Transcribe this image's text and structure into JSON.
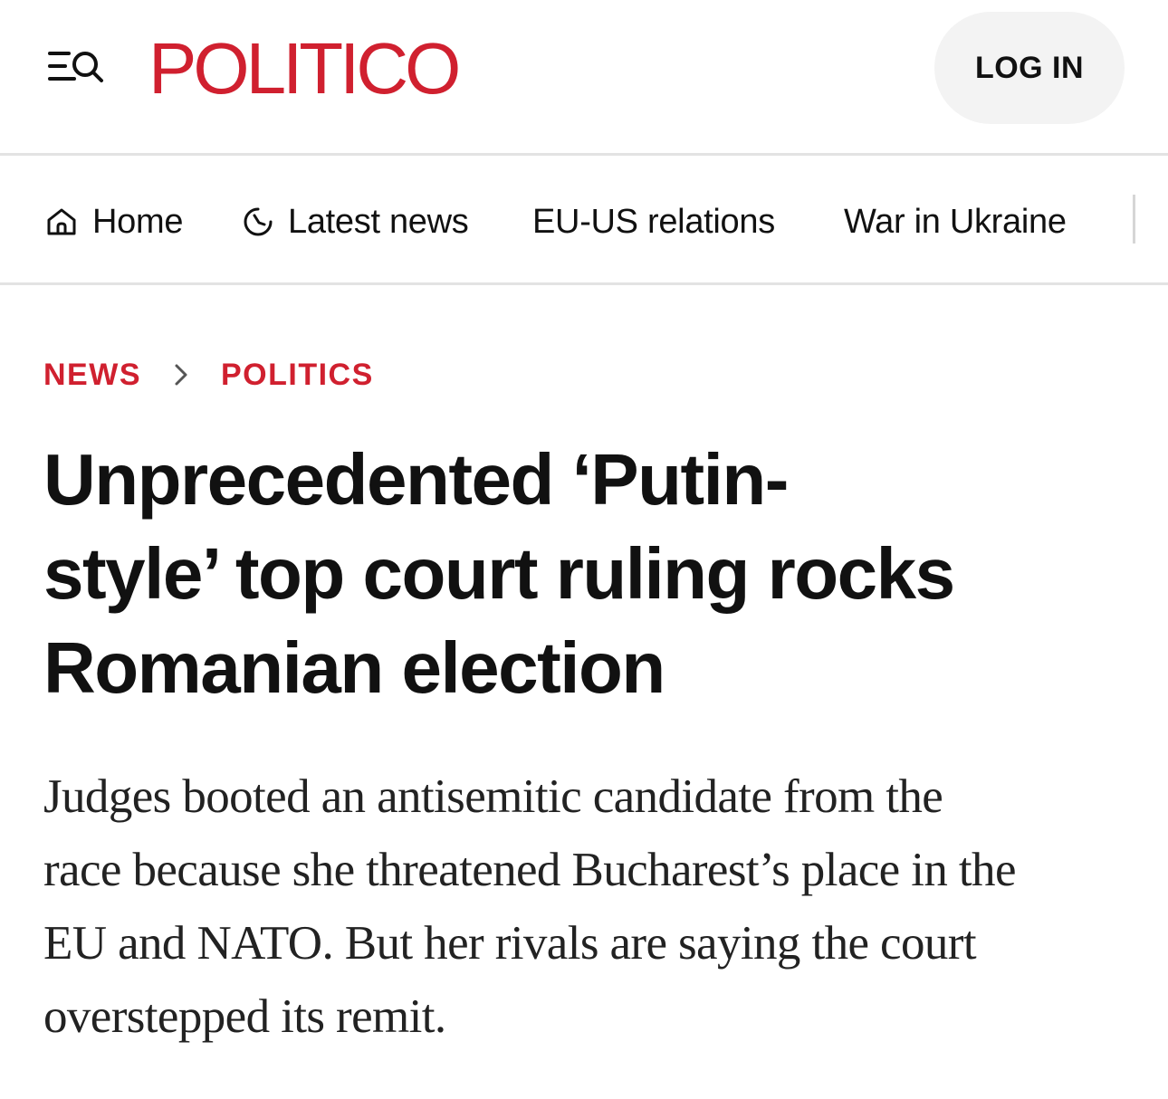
{
  "header": {
    "menu_icon": "menu-search-icon",
    "logo_text": "POLITICO",
    "login_label": "LOG IN",
    "brand_color": "#d0202f"
  },
  "nav": {
    "items": [
      {
        "label": "Home",
        "icon": "home-icon"
      },
      {
        "label": "Latest news",
        "icon": "clock-icon"
      },
      {
        "label": "EU-US relations"
      },
      {
        "label": "War in Ukraine"
      }
    ]
  },
  "breadcrumb": {
    "items": [
      "NEWS",
      "POLITICS"
    ],
    "separator_icon": "chevron-right-icon"
  },
  "article": {
    "headline_lines": [
      "Unprecedented ‘Putin-",
      "style’ top court ruling rocks",
      "Romanian election"
    ],
    "dek_lines": [
      "Judges booted an antisemitic candidate from the",
      "race because she threatened Bucharest’s place in the",
      "EU and NATO. But her rivals are saying the court",
      "overstepped its remit."
    ]
  }
}
